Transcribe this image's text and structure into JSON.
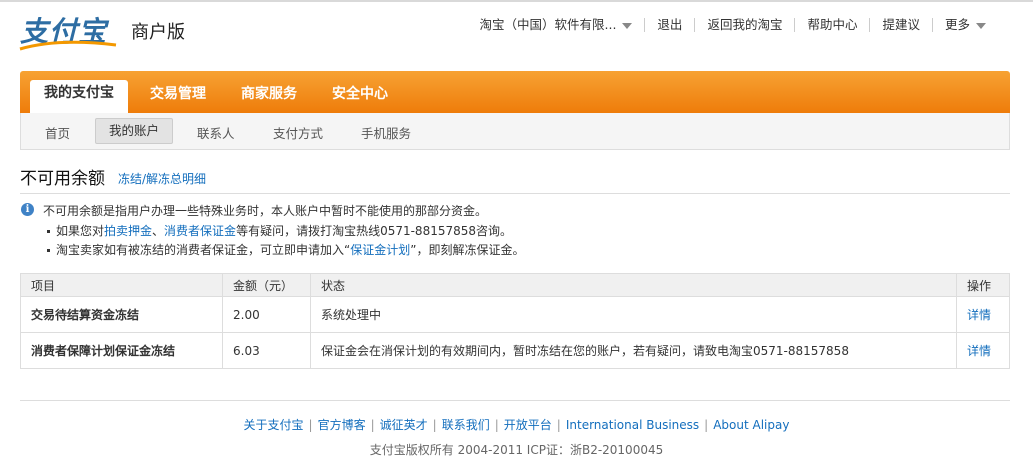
{
  "header": {
    "logo_text": "支付宝",
    "edition": "商户版",
    "account": "淘宝（中国）软件有限...",
    "links": [
      "退出",
      "返回我的淘宝",
      "帮助中心",
      "提建议"
    ],
    "more": "更多"
  },
  "main_nav": [
    "我的支付宝",
    "交易管理",
    "商家服务",
    "安全中心"
  ],
  "sub_nav": [
    "首页",
    "我的账户",
    "联系人",
    "支付方式",
    "手机服务"
  ],
  "page": {
    "title": "不可用余额",
    "title_link": "冻结/解冻总明细"
  },
  "notice": {
    "main": "不可用余额是指用户办理一些特殊业务时，本人账户中暂时不能使用的那部分资金。",
    "b1_pre": "如果您对",
    "b1_link1": "拍卖押金",
    "b1_mid": "、",
    "b1_link2": "消费者保证金",
    "b1_post": "等有疑问，请拨打淘宝热线0571-88157858咨询。",
    "b2_pre": "淘宝卖家如有被冻结的消费者保证金，可立即申请加入“",
    "b2_link": "保证金计划",
    "b2_post": "”，即刻解冻保证金。"
  },
  "table": {
    "headers": [
      "项目",
      "金额（元）",
      "状态",
      "操作"
    ],
    "rows": [
      {
        "item": "交易待结算资金冻结",
        "amount": "2.00",
        "status": "系统处理中",
        "op": "详情"
      },
      {
        "item": "消费者保障计划保证金冻结",
        "amount": "6.03",
        "status": "保证金会在消保计划的有效期间内，暂时冻结在您的账户，若有疑问，请致电淘宝0571-88157858",
        "op": "详情"
      }
    ]
  },
  "footer": {
    "links": [
      "关于支付宝",
      "官方博客",
      "诚征英才",
      "联系我们",
      "开放平台",
      "International Business",
      "About Alipay"
    ],
    "copyright": "支付宝版权所有 2004-2011 ICP证：浙B2-20100045"
  },
  "colors": {
    "brand_orange": "#ee7c0a",
    "link_blue": "#136ebd",
    "logo_blue": "#2d6da3"
  },
  "icons": [
    "info-icon",
    "caret-down-icon"
  ]
}
